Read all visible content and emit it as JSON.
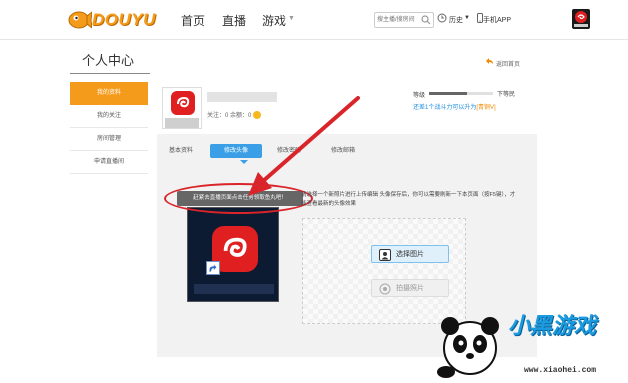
{
  "brand": {
    "name": "DOUYU"
  },
  "nav": {
    "items": [
      {
        "label": "首页"
      },
      {
        "label": "直播"
      },
      {
        "label": "游戏"
      }
    ]
  },
  "search": {
    "placeholder": "搜主播/搜房间"
  },
  "top_right": {
    "history": "历史",
    "mobile_app": "手机APP"
  },
  "header": {
    "title": "个人中心",
    "back_link": "返回首页"
  },
  "sidebar": {
    "items": [
      {
        "label": "我的资料",
        "active": true
      },
      {
        "label": "我的关注",
        "active": false
      },
      {
        "label": "房间管理",
        "active": false
      },
      {
        "label": "申请直播间",
        "active": false
      }
    ]
  },
  "profile": {
    "stats": "关注：0  余额：0",
    "level_label": "等级",
    "level_progress": 0.6,
    "level_name": "下等民",
    "level_tip_prefix": "还差1个战斗力可以升为",
    "level_tip_vip": "[青铜V]"
  },
  "tabs": [
    {
      "label": "基本资料",
      "active": false
    },
    {
      "label": "修改头像",
      "active": true
    },
    {
      "label": "修改密码",
      "active": false
    },
    {
      "label": "修改邮箱",
      "active": false
    }
  ],
  "tooltip": {
    "text": "赶紧去直播页面点击任务领取鱼丸吧！"
  },
  "instructions": {
    "text": "请选择一个新照片进行上传编辑 头像保存后，你可以需要刷新一下本页面（按F5键），才能查看最新的头像效果"
  },
  "upload": {
    "select_button": "选择图片",
    "photo_button": "拍摄照片"
  },
  "watermark": {
    "text": "小黑游戏",
    "url": "www.xiaohei.com"
  },
  "colors": {
    "accent": "#f59b1c",
    "tab_active": "#3a9fe6",
    "annotation": "#d9242a"
  }
}
